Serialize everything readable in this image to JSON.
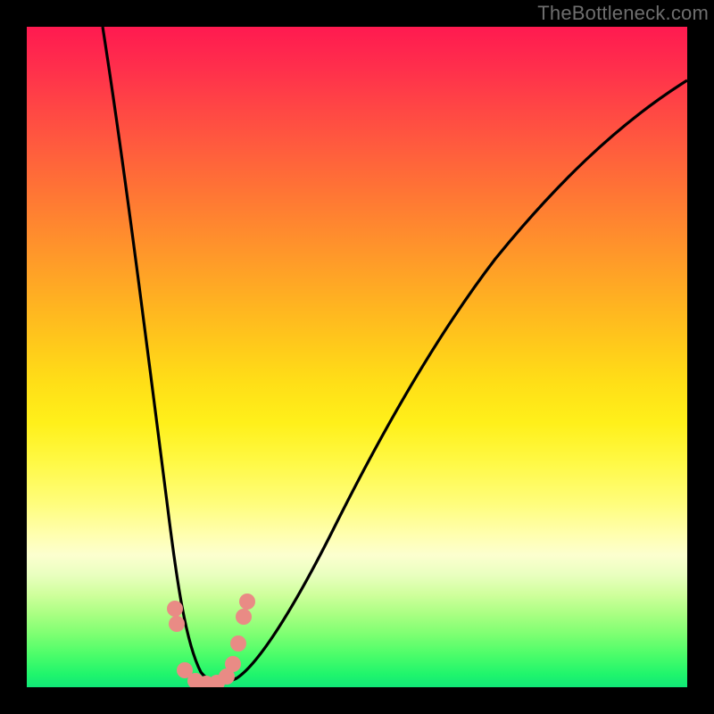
{
  "watermark": "TheBottleneck.com",
  "chart_data": {
    "type": "line",
    "title": "",
    "xlabel": "",
    "ylabel": "",
    "xlim": [
      0,
      100
    ],
    "ylim": [
      0,
      100
    ],
    "grid": false,
    "background_gradient": {
      "top": "#ff1a50",
      "mid": "#fff01a",
      "bottom": "#11e877"
    },
    "series": [
      {
        "name": "bottleneck-curve",
        "color": "#000000",
        "x": [
          12,
          14,
          16,
          18,
          20,
          22,
          24,
          25,
          26,
          27,
          28,
          30,
          32,
          35,
          40,
          45,
          50,
          55,
          60,
          65,
          70,
          75,
          80,
          85,
          90,
          95,
          100
        ],
        "y": [
          100,
          88,
          75,
          62,
          48,
          33,
          18,
          10,
          5,
          2,
          0,
          0,
          2,
          6,
          15,
          25,
          34,
          42,
          49,
          55,
          60,
          65,
          69,
          73,
          76,
          79,
          81
        ]
      },
      {
        "name": "valley-markers",
        "color": "#e98b85",
        "type": "scatter",
        "x": [
          22.5,
          22.8,
          24.0,
          25.5,
          27.0,
          28.5,
          30.0,
          31.0,
          31.5,
          32.2,
          32.8
        ],
        "y": [
          12.0,
          9.5,
          2.5,
          0.8,
          0.5,
          0.6,
          1.5,
          3.5,
          6.5,
          10.5,
          13.0
        ]
      }
    ],
    "annotations": []
  }
}
